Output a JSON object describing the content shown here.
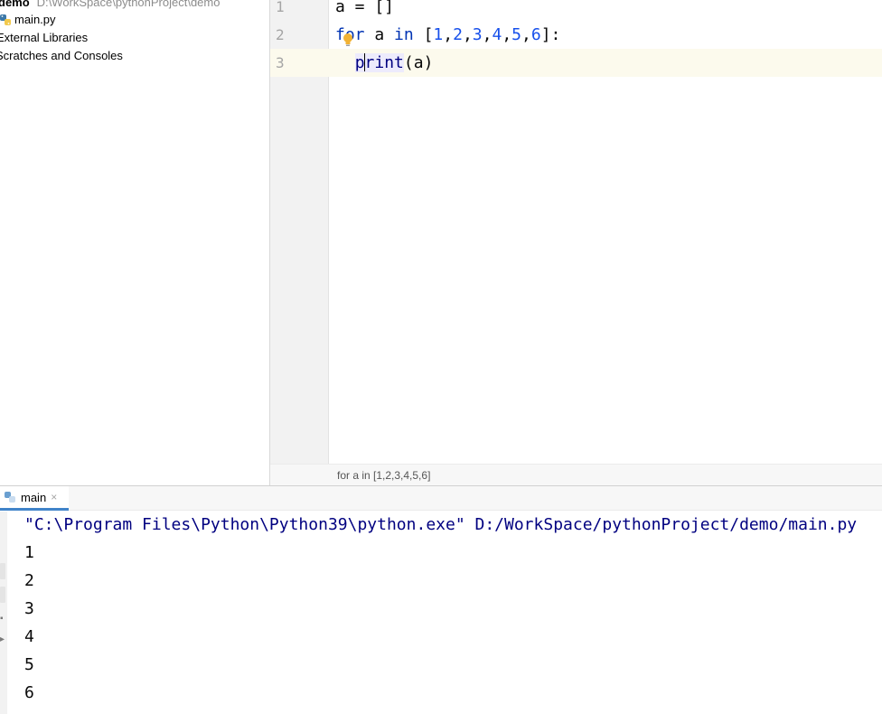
{
  "project_tree": {
    "root": {
      "name": "demo",
      "path": "D:\\WorkSpace\\pythonProject\\demo"
    },
    "items": [
      {
        "label": "main.py"
      },
      {
        "label": "External Libraries"
      },
      {
        "label": "Scratches and Consoles"
      }
    ]
  },
  "editor": {
    "line_numbers": [
      "1",
      "2",
      "3"
    ],
    "line1": {
      "text": "a = []"
    },
    "line2": {
      "kw_for": "for",
      "var": " a ",
      "kw_in": "in",
      "sp": " ",
      "lb": "[",
      "n1": "1",
      "n2": "2",
      "n3": "3",
      "n4": "4",
      "n5": "5",
      "n6": "6",
      "comma": ",",
      "rb_colon": "]:"
    },
    "line3": {
      "indent": "  ",
      "print_a": "p",
      "print_b": "rint",
      "args": "(a)"
    },
    "breadcrumb": "for a in [1,2,3,4,5,6]"
  },
  "run": {
    "tab_label": "main",
    "close_glyph": "×",
    "command": "\"C:\\Program Files\\Python\\Python39\\python.exe\" D:/WorkSpace/pythonProject/demo/main.py",
    "output": [
      "1",
      "2",
      "3",
      "4",
      "5",
      "6"
    ]
  },
  "colors": {
    "keyword": "#0033b3",
    "number": "#1750eb",
    "builtin": "#000080",
    "caret_row": "#fcfaed",
    "tab_underline": "#4083c9"
  }
}
